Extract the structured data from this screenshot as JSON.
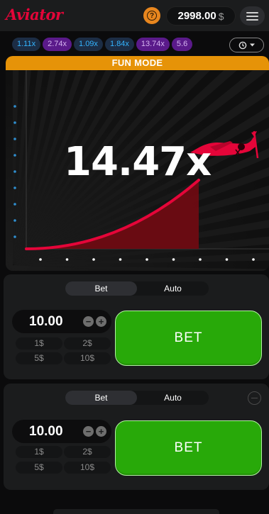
{
  "header": {
    "logo": "Aviator",
    "balance": "2998.00",
    "currency": "$"
  },
  "multipliers": [
    {
      "value": "1.11x",
      "tier": "blue"
    },
    {
      "value": "2.74x",
      "tier": "purple"
    },
    {
      "value": "1.09x",
      "tier": "blue"
    },
    {
      "value": "1.84x",
      "tier": "blue"
    },
    {
      "value": "13.74x",
      "tier": "purple"
    },
    {
      "value": "5.6",
      "tier": "purple"
    }
  ],
  "game": {
    "banner": "FUN MODE",
    "multiplier": "14.47x"
  },
  "bet_panels": [
    {
      "tabs": [
        "Bet",
        "Auto"
      ],
      "active_tab": "Bet",
      "amount": "10.00",
      "minus": "−",
      "plus": "+",
      "quick": [
        "1$",
        "2$",
        "5$",
        "10$"
      ],
      "button": "BET"
    },
    {
      "tabs": [
        "Bet",
        "Auto"
      ],
      "active_tab": "Bet",
      "amount": "10.00",
      "minus": "−",
      "plus": "+",
      "quick": [
        "1$",
        "2$",
        "5$",
        "10$"
      ],
      "button": "BET"
    }
  ],
  "icons": {
    "help": "help-icon",
    "menu": "menu-icon",
    "history": "history-icon",
    "plane": "plane-icon"
  },
  "colors": {
    "brand_red": "#e50539",
    "fun_mode": "#e69308",
    "bet_green": "#28a909",
    "mult_blue": "#34b4ff",
    "mult_purple": "#d5b4f0"
  }
}
